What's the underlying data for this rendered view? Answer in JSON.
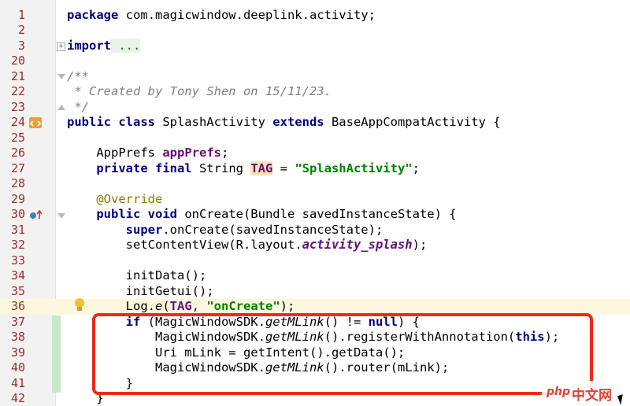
{
  "editor": {
    "lines": [
      {
        "n": "1",
        "segs": [
          [
            "kw",
            "package"
          ],
          [
            "",
            " com.magicwindow.deeplink.activity;"
          ]
        ]
      },
      {
        "n": "2",
        "segs": []
      },
      {
        "n": "3",
        "segs": [
          [
            "kw",
            "import"
          ],
          [
            "",
            ""
          ],
          [
            "folded",
            " ..."
          ]
        ]
      },
      {
        "n": "20",
        "segs": []
      },
      {
        "n": "21",
        "segs": [
          [
            "com",
            "/**"
          ]
        ]
      },
      {
        "n": "22",
        "segs": [
          [
            "com",
            " * Created by Tony Shen on 15/11/23."
          ]
        ]
      },
      {
        "n": "23",
        "segs": [
          [
            "com",
            " */"
          ]
        ]
      },
      {
        "n": "24",
        "segs": [
          [
            "kw",
            "public class"
          ],
          [
            "",
            " SplashActivity "
          ],
          [
            "kw",
            "extends"
          ],
          [
            "",
            " BaseAppCompatActivity {"
          ]
        ]
      },
      {
        "n": "25",
        "segs": []
      },
      {
        "n": "26",
        "segs": [
          [
            "",
            "    AppPrefs "
          ],
          [
            "fld",
            "appPrefs"
          ],
          [
            "",
            ";"
          ]
        ]
      },
      {
        "n": "27",
        "segs": [
          [
            "",
            "    "
          ],
          [
            "kw",
            "private final"
          ],
          [
            "",
            " String "
          ],
          [
            "fld hl-ref",
            "TAG"
          ],
          [
            "",
            " = "
          ],
          [
            "str",
            "\"SplashActivity\""
          ],
          [
            "",
            ";"
          ]
        ]
      },
      {
        "n": "28",
        "segs": []
      },
      {
        "n": "29",
        "segs": [
          [
            "ann",
            "    @Override"
          ]
        ]
      },
      {
        "n": "30",
        "segs": [
          [
            "",
            "    "
          ],
          [
            "kw",
            "public void"
          ],
          [
            "",
            " onCreate(Bundle savedInstanceState) {"
          ]
        ]
      },
      {
        "n": "31",
        "segs": [
          [
            "",
            "        "
          ],
          [
            "kw",
            "super"
          ],
          [
            "",
            ".onCreate(savedInstanceState);"
          ]
        ]
      },
      {
        "n": "32",
        "segs": [
          [
            "",
            "        setContentView(R.layout."
          ],
          [
            "const",
            "activity_splash"
          ],
          [
            "",
            ");"
          ]
        ]
      },
      {
        "n": "33",
        "segs": []
      },
      {
        "n": "34",
        "segs": [
          [
            "",
            "        initData();"
          ]
        ]
      },
      {
        "n": "35",
        "segs": [
          [
            "",
            "        initGetui();"
          ]
        ]
      },
      {
        "n": "36",
        "segs": [
          [
            "",
            "        Log."
          ],
          [
            "static-call",
            "e"
          ],
          [
            "",
            "("
          ],
          [
            "fld",
            "TAG"
          ],
          [
            "",
            ", "
          ],
          [
            "str",
            "\"onCreate\""
          ],
          [
            "",
            ");"
          ]
        ]
      },
      {
        "n": "37",
        "segs": [
          [
            "",
            "        "
          ],
          [
            "kw",
            "if"
          ],
          [
            "",
            " (MagicWindowSDK."
          ],
          [
            "static-call",
            "getMLink"
          ],
          [
            "",
            "() != "
          ],
          [
            "kw",
            "null"
          ],
          [
            "",
            ") {"
          ]
        ]
      },
      {
        "n": "38",
        "segs": [
          [
            "",
            "            MagicWindowSDK."
          ],
          [
            "static-call",
            "getMLink"
          ],
          [
            "",
            "().registerWithAnnotation("
          ],
          [
            "kw",
            "this"
          ],
          [
            "",
            ");"
          ]
        ]
      },
      {
        "n": "39",
        "segs": [
          [
            "",
            "            Uri mLink = getIntent().getData();"
          ]
        ]
      },
      {
        "n": "40",
        "segs": [
          [
            "",
            "            MagicWindowSDK."
          ],
          [
            "static-call",
            "getMLink"
          ],
          [
            "",
            "().router(mLink);"
          ]
        ]
      },
      {
        "n": "41",
        "segs": [
          [
            "",
            "        }"
          ]
        ]
      },
      {
        "n": "42",
        "segs": [
          [
            "",
            "    }"
          ]
        ]
      }
    ]
  },
  "watermark": {
    "php": "php",
    "cn": "中文网"
  },
  "colors": {
    "highlight_box": "#ee2a1b",
    "keyword": "#000080",
    "field": "#660e7a",
    "string": "#008000",
    "line_number": "#a32a2a"
  },
  "icons": [
    "fold-plus-icon",
    "fold-collapse-icon",
    "class-marker-icon",
    "override-marker-icon",
    "lightbulb-icon",
    "mouse-cursor-icon"
  ]
}
